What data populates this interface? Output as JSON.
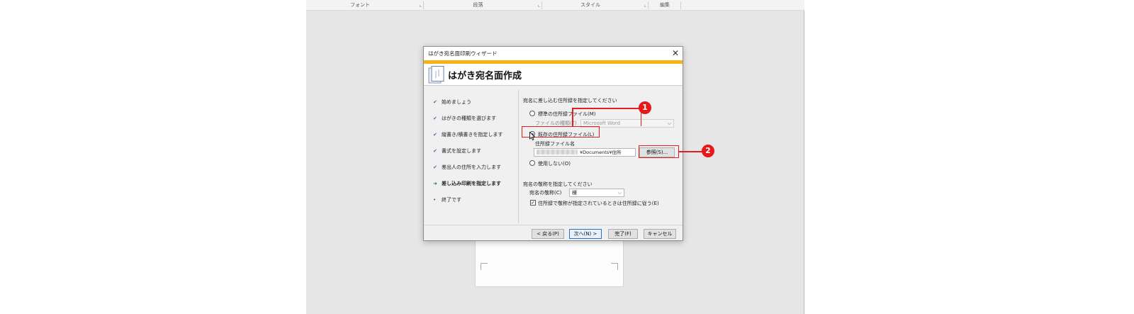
{
  "ribbon": {
    "groups": [
      {
        "label": "フォント"
      },
      {
        "label": "段落"
      },
      {
        "label": "スタイル"
      },
      {
        "label": "編集"
      }
    ],
    "launcher_glyph": "⌞"
  },
  "dialog": {
    "title": "はがき宛名面印刷ウィザード",
    "close_glyph": "✕",
    "banner_title": "はがき宛名面作成",
    "steps": [
      {
        "label": "始めましょう",
        "state": "done"
      },
      {
        "label": "はがきの種類を選びます",
        "state": "done"
      },
      {
        "label": "縦書き/横書きを指定します",
        "state": "done"
      },
      {
        "label": "書式を設定します",
        "state": "done"
      },
      {
        "label": "差出人の住所を入力します",
        "state": "done"
      },
      {
        "label": "差し込み印刷を指定します",
        "state": "current"
      },
      {
        "label": "終了です",
        "state": "todo"
      }
    ],
    "step_marks": {
      "done": "✔",
      "current": "➜",
      "todo": "•"
    },
    "address_section": {
      "heading": "宛名に差し込む住所録を指定してください",
      "option_standard": "標準の住所録ファイル(M)",
      "filetype_label": "ファイルの種類(T)",
      "filetype_value": "Microsoft Word",
      "option_existing": "既存の住所録ファイル(L)",
      "filename_label": "住所録ファイル名",
      "filename_value": "¥Documents¥住所録.xlsx",
      "browse_button": "参照(S)...",
      "option_none": "使用しない(O)"
    },
    "honorific_section": {
      "heading": "宛名の敬称を指定してください",
      "label": "宛名の敬称(C)",
      "value": "様",
      "checkbox_label": "住所録で敬称が指定されているときは住所録に従う(E)",
      "checkbox_checked": true
    },
    "buttons": {
      "back": "< 戻る(P)",
      "next": "次へ(N) >",
      "finish": "完了(F)",
      "cancel": "キャンセル"
    }
  },
  "annotations": {
    "badge1": "1",
    "badge2": "2",
    "color": "#e02020"
  },
  "colors": {
    "banner_accent": "#f6b21b",
    "badge_red": "#e81818"
  }
}
